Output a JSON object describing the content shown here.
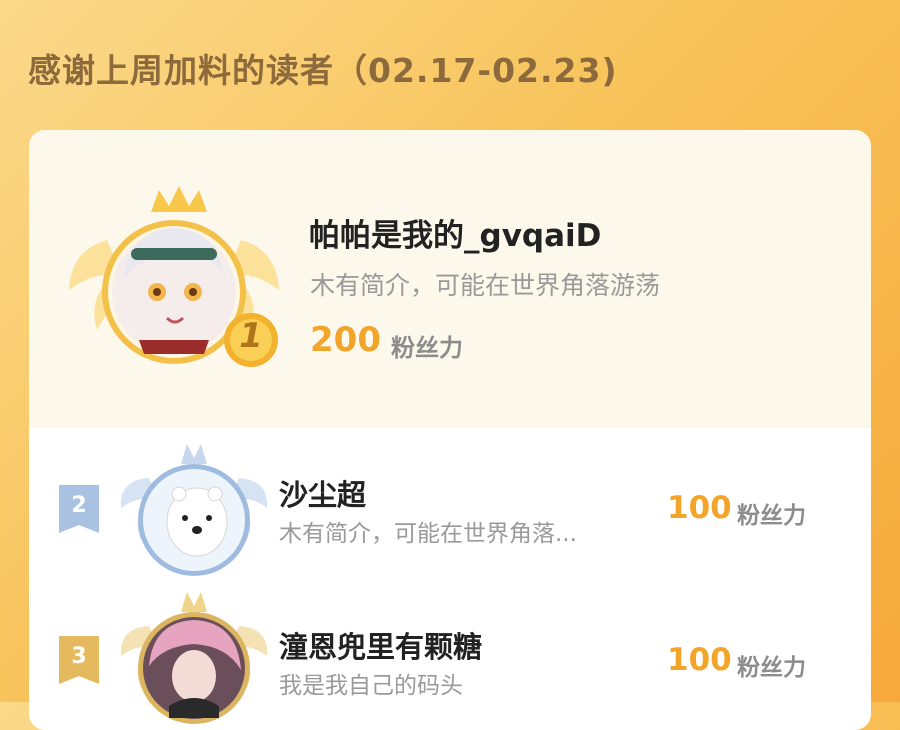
{
  "header": {
    "title": "感谢上周加料的读者（02.17-02.23)"
  },
  "leaderboard": [
    {
      "rank": "1",
      "name": "帕帕是我的_gvqaiD",
      "bio": "木有简介，可能在世界角落游荡",
      "fans": "200",
      "fans_label": "粉丝力"
    },
    {
      "rank": "2",
      "name": "沙尘超",
      "bio": "木有简介，可能在世界角落...",
      "fans": "100",
      "fans_label": "粉丝力"
    },
    {
      "rank": "3",
      "name": "潼恩兜里有颗糖",
      "bio": "我是我自己的码头",
      "fans": "100",
      "fans_label": "粉丝力"
    }
  ],
  "colors": {
    "gold": "#f3a52a",
    "silver_badge": "#9fb8d8",
    "bronze_badge": "#e2b45c"
  }
}
